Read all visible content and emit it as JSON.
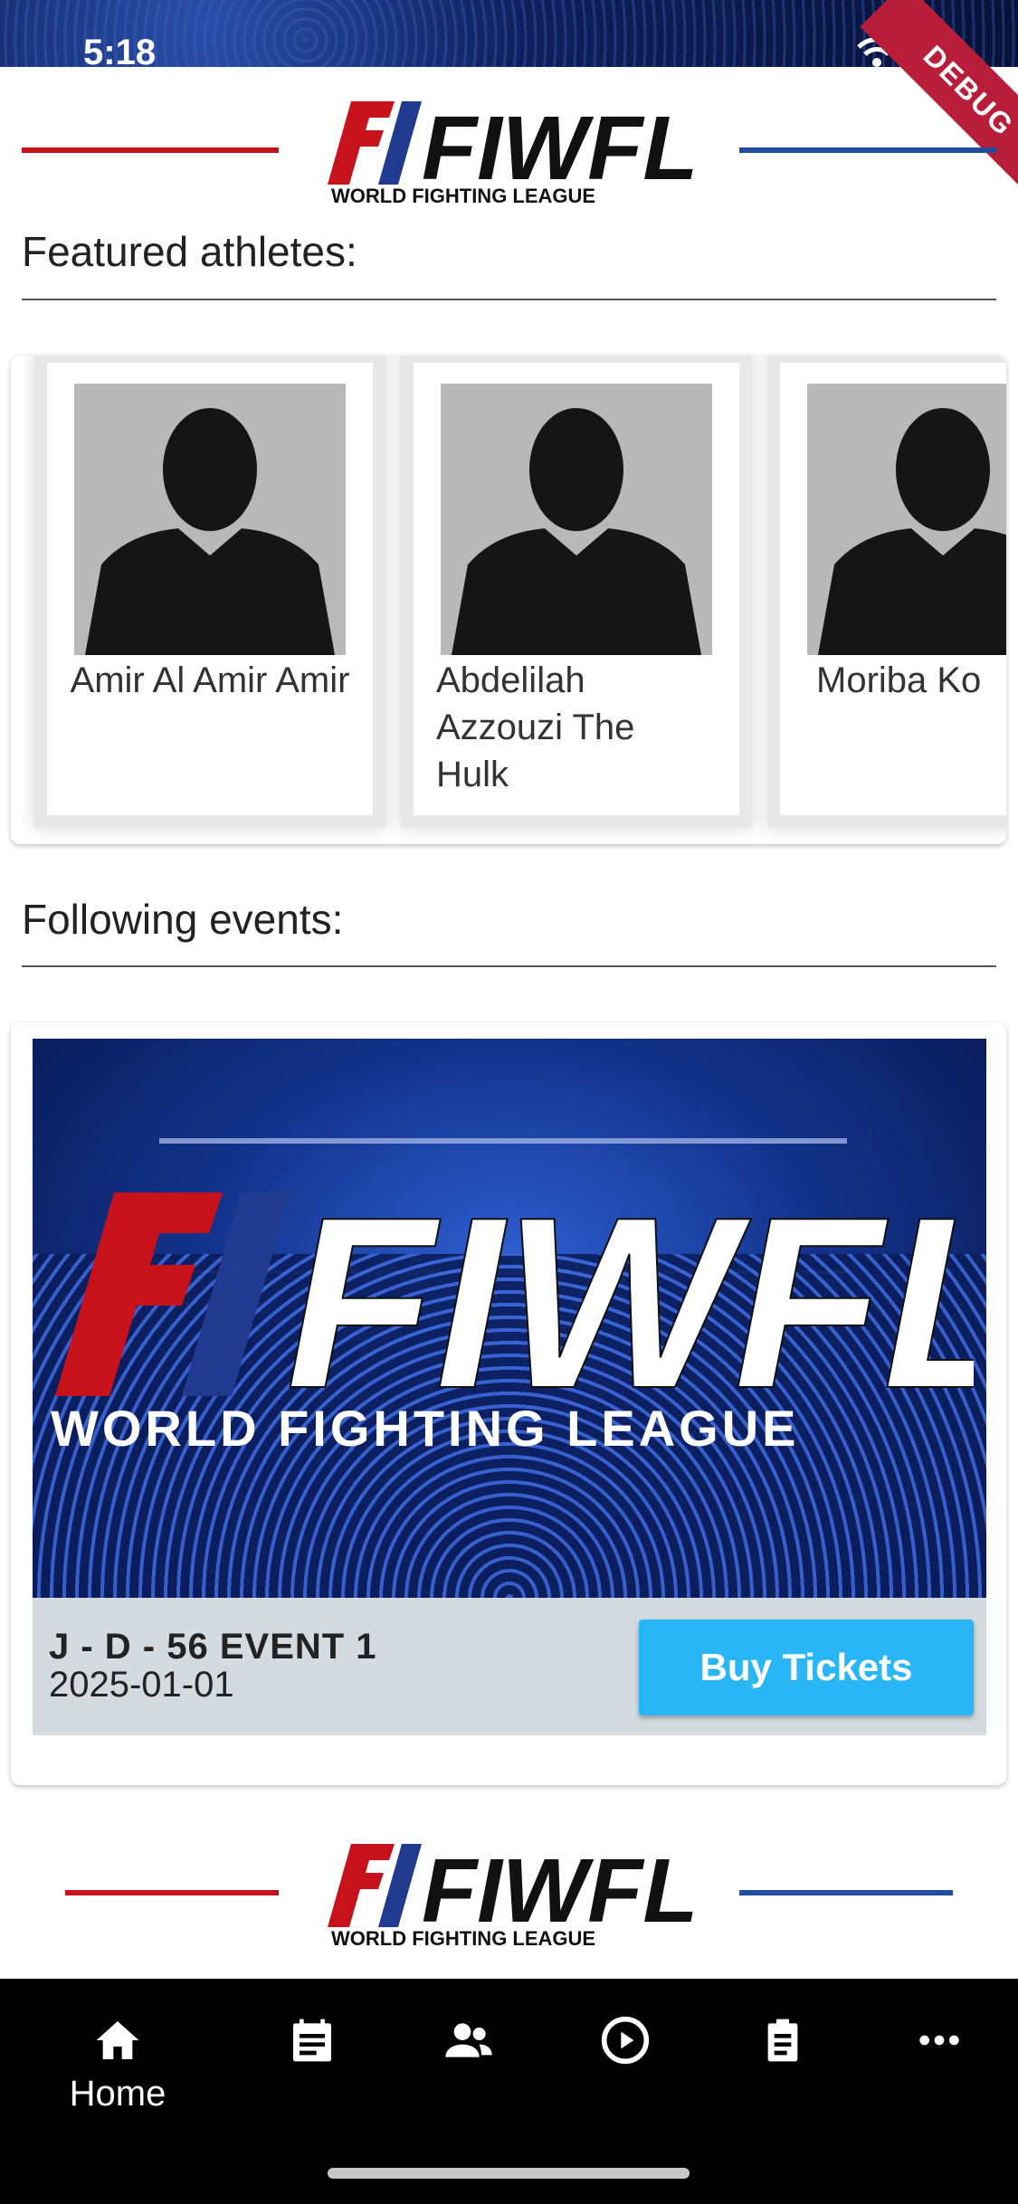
{
  "status_bar": {
    "time": "5:18"
  },
  "debug_banner": "DEBUG",
  "logo": {
    "letters": "FIWFL",
    "tagline": "WORLD FIGHTING LEAGUE"
  },
  "featured": {
    "title": "Featured athletes:",
    "athletes": [
      {
        "name": "Amir Al Amir Amir"
      },
      {
        "name": "Abdelilah Azzouzi The Hulk"
      },
      {
        "name": "Moriba Ko"
      }
    ]
  },
  "events": {
    "title": "Following events:",
    "items": [
      {
        "name": "J - D - 56 EVENT 1",
        "date": "2025-01-01",
        "cta": "Buy Tickets",
        "banner": {
          "letters": "FIWFL",
          "tagline": "WORLD FIGHTING LEAGUE"
        }
      }
    ]
  },
  "nav": {
    "items": [
      {
        "label": "Home",
        "icon": "home-icon"
      },
      {
        "label": "",
        "icon": "calendar-icon"
      },
      {
        "label": "",
        "icon": "people-icon"
      },
      {
        "label": "",
        "icon": "play-circle-icon"
      },
      {
        "label": "",
        "icon": "clipboard-icon"
      },
      {
        "label": "",
        "icon": "more-icon"
      }
    ]
  },
  "colors": {
    "accent_red": "#c8121b",
    "accent_blue": "#1f4ea1",
    "button": "#29b6f6",
    "nav_bg": "#000000"
  }
}
